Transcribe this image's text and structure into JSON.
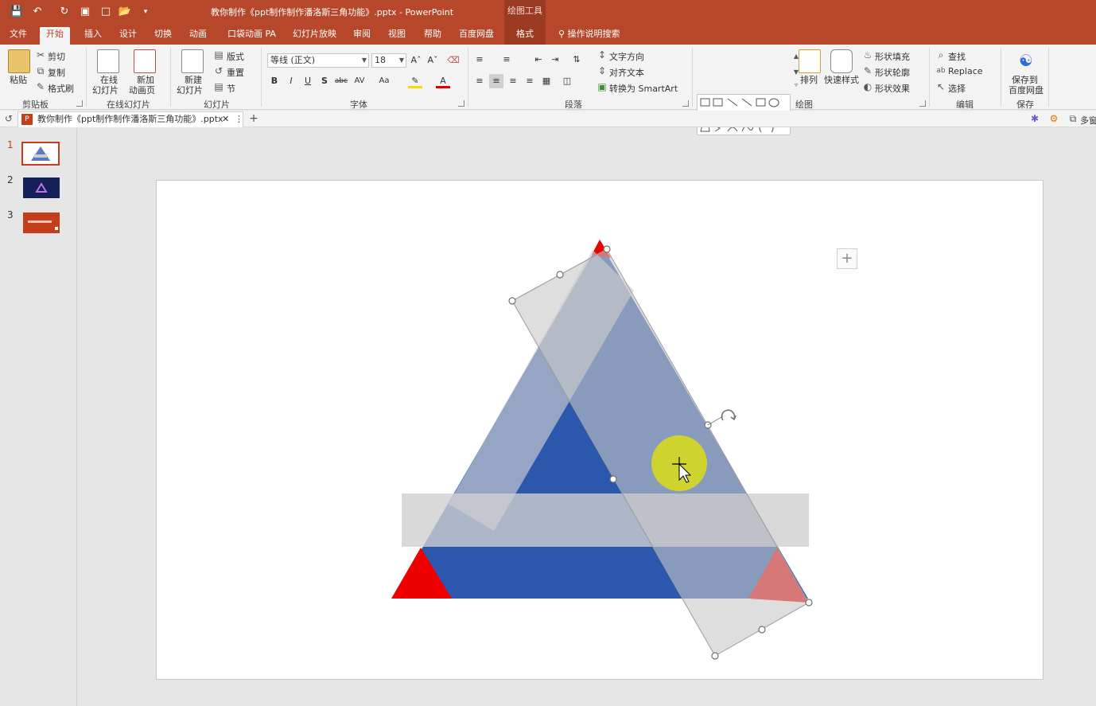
{
  "window": {
    "title": "教你制作《ppt制作制作潘洛斯三角功能》.pptx  -  PowerPoint",
    "context_header": "绘图工具"
  },
  "tabs": [
    {
      "label": "文件"
    },
    {
      "label": "开始"
    },
    {
      "label": "插入"
    },
    {
      "label": "设计"
    },
    {
      "label": "切换"
    },
    {
      "label": "动画"
    },
    {
      "label": "口袋动画 PA"
    },
    {
      "label": "幻灯片放映"
    },
    {
      "label": "审阅"
    },
    {
      "label": "视图"
    },
    {
      "label": "帮助"
    },
    {
      "label": "百度网盘"
    },
    {
      "label": "格式"
    }
  ],
  "tell_me": "操作说明搜索",
  "ribbon": {
    "clipboard": {
      "paste": "粘贴",
      "cut": "剪切",
      "copy": "复制",
      "format_painter": "格式刷",
      "label": "剪贴板"
    },
    "online_slides": {
      "online": "在线",
      "online2": "幻灯片",
      "new_anim": "新加",
      "new_anim2": "动画页",
      "label": "在线幻灯片"
    },
    "slides": {
      "new": "新建",
      "new2": "幻灯片",
      "layout": "版式",
      "reset": "重置",
      "section": "节",
      "label": "幻灯片"
    },
    "font": {
      "name": "等线 (正文)",
      "size": "18",
      "label": "字体"
    },
    "paragraph": {
      "text_direction": "文字方向",
      "align_text": "对齐文本",
      "smartart": "转换为 SmartArt",
      "label": "段落"
    },
    "drawing": {
      "arrange": "排列",
      "quick_styles": "快速样式",
      "fill": "形状填充",
      "outline": "形状轮廓",
      "effects": "形状效果",
      "label": "绘图"
    },
    "editing": {
      "find": "查找",
      "replace": "Replace",
      "select": "选择",
      "label": "编辑"
    },
    "save": {
      "save_to": "保存到",
      "save_to2": "百度网盘",
      "label": "保存"
    }
  },
  "doc_tab": {
    "label": "教你制作《ppt制作制作潘洛斯三角功能》.pptx",
    "right_label": "多窗"
  },
  "thumbnails": [
    {
      "num": "1"
    },
    {
      "num": "2"
    },
    {
      "num": "3"
    }
  ],
  "colors": {
    "accent": "#b7472a",
    "blue": "#2b57ad",
    "red": "#ee0000",
    "overlay": "#d9d9d9",
    "pointer": "#e6e600"
  }
}
